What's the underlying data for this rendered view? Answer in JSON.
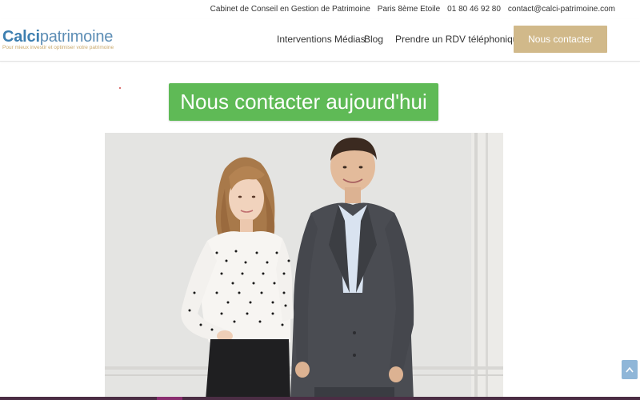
{
  "topbar": {
    "tagline": "Cabinet de Conseil en Gestion de Patrimoine",
    "location": "Paris 8ème Etoile",
    "phone": "01 80 46 92 80",
    "email": "contact@calci-patrimoine.com"
  },
  "header": {
    "logo_calci": "Calci",
    "logo_patrimoine": "patrimoine",
    "logo_tagline": "Pour mieux investir et optimiser votre patrimoine",
    "nav": [
      {
        "label": "Interventions Médias"
      },
      {
        "label": "Blog"
      },
      {
        "label": "Prendre un RDV téléphonique"
      }
    ],
    "cta_label": "Nous contacter"
  },
  "main": {
    "contact_button_label": "Nous contacter aujourd'hui"
  },
  "colors": {
    "gold": "#d1b98a",
    "green": "#5fba56",
    "logo_blue": "#3d7fb0",
    "bottom_strip": "#4b2d44"
  },
  "icons": {
    "scroll_top": "chevron-up-icon"
  }
}
